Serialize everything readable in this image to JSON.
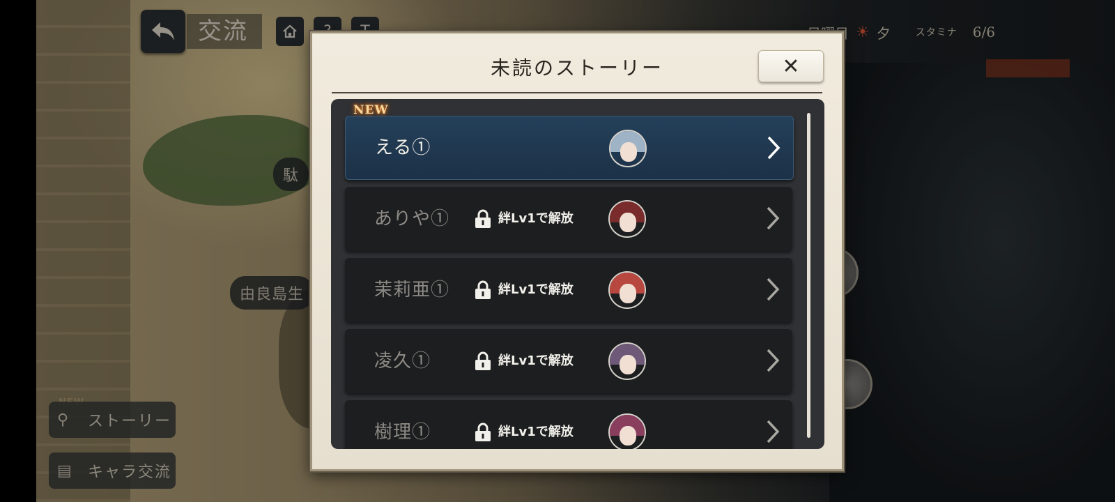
{
  "header": {
    "back_icon": "back-arrow-icon",
    "title": "交流",
    "home_icon": "home-icon",
    "help_label": "?",
    "text_label": "T"
  },
  "status": {
    "day": "日曜日",
    "time_icon": "sunset-icon",
    "time_of_day": "夕",
    "stamina_label": "スタミナ",
    "stamina_value": "6/6"
  },
  "map_labels": {
    "upper": "駄",
    "lower": "由良島生"
  },
  "side_menu": {
    "new_badge": "NEW",
    "items": [
      {
        "label": "ストーリー",
        "icon": "bicycle-icon"
      },
      {
        "label": "キャラ交流",
        "icon": "cards-icon"
      }
    ]
  },
  "modal": {
    "title": "未読のストーリー",
    "close_label": "✕",
    "new_badge": "NEW",
    "stories": [
      {
        "name": "える①",
        "locked": false,
        "lock_text": "",
        "avatar_hair": "#9fb3c7"
      },
      {
        "name": "ありや①",
        "locked": true,
        "lock_text": "絆Lv1で解放",
        "avatar_hair": "#7a2c2c"
      },
      {
        "name": "茉莉亜①",
        "locked": true,
        "lock_text": "絆Lv1で解放",
        "avatar_hair": "#b8473f"
      },
      {
        "name": "凌久①",
        "locked": true,
        "lock_text": "絆Lv1で解放",
        "avatar_hair": "#6e5a78"
      },
      {
        "name": "樹理①",
        "locked": true,
        "lock_text": "絆Lv1で解放",
        "avatar_hair": "#8a3e5e"
      }
    ]
  }
}
